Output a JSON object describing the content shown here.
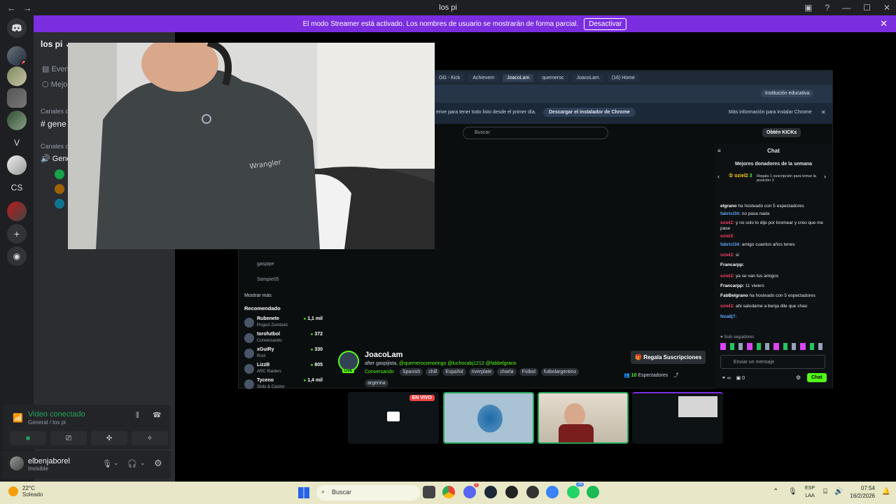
{
  "titlebar": {
    "title": "los pi"
  },
  "banner": {
    "text": "El modo Streamer está activado. Los nombres de usuario se mostrarán de forma parcial.",
    "button": "Desactivar"
  },
  "rail": {
    "badge_count": "1",
    "letter_v": "V",
    "letters_cs": "CS"
  },
  "sidebar": {
    "server_name": "los pi",
    "items": [
      "Even",
      "Mejo"
    ],
    "categories": [
      "Canales d",
      "Canales d"
    ],
    "text_channel": "gene",
    "voice_channel": "Gene"
  },
  "voice": {
    "status": "Video conectado",
    "location": "General / los pi"
  },
  "user": {
    "name": "elbenjaborel",
    "status": "Invisible"
  },
  "browser": {
    "tabs": [
      "OG - Kick",
      "Achievem",
      "JoacoLam",
      "quemeroc",
      "JoacoLam",
      "(16) Home"
    ],
    "profile": "Institución educativa",
    "chrome_msg": "erive para tener todo listo desde el primer día.",
    "chrome_dl": "Descargar el instalador de Chrome",
    "chrome_more": "Más información para instalar Chrome",
    "search_placeholder": "Buscar",
    "kicks": "Obtén KICKs"
  },
  "sidelist": {
    "followed": [
      "gaspipe",
      "Sampie05"
    ],
    "more": "Mostrar más",
    "recommended_title": "Recomendado",
    "recommended": [
      {
        "name": "Rubenete",
        "game": "Project Zomboid",
        "viewers": "1,1 mil"
      },
      {
        "name": "torofutbol",
        "game": "Conversando",
        "viewers": "372"
      },
      {
        "name": "xGuiRy",
        "game": "Rust",
        "viewers": "330"
      },
      {
        "name": "LizzB",
        "game": "ARC Raiders",
        "viewers": "805"
      },
      {
        "name": "Tyceno",
        "game": "Slots & Casino",
        "viewers": "1,4 mil"
      }
    ]
  },
  "stream": {
    "name": "JoacoLam",
    "title_prefix": "after gaspijista, ",
    "title_mentions": "@quemerocomoringo @luchocabj1212 @fabbelgrano",
    "category": "Conversando",
    "tags": [
      "Spanish",
      "chill",
      "Español",
      "riverplate",
      "charla",
      "Fútbol",
      "futbolargentino",
      "argerina"
    ],
    "live": "LIVE",
    "subs_button": "Regala Suscripciones",
    "viewers_num": "10",
    "viewers_label": "Espectadores"
  },
  "chat": {
    "title": "Chat",
    "donors_title": "Mejores donadores de la semana",
    "donor_name": "oziel2",
    "donor_count": "3",
    "donor_note": "Regala 1 suscripción para tomar la posición 2",
    "messages": [
      {
        "user": "elgrano",
        "text": " ha hosteado con 5 espectadores",
        "color": "#ffffff"
      },
      {
        "user": "fabrici34:",
        "text": " no pasa nada",
        "color": "#60a5fa"
      },
      {
        "user": "oziel2:",
        "text": " y no solo lo dije por bromear y creo que me pase",
        "color": "#f43f5e"
      },
      {
        "user": "oziel2:",
        "text": "",
        "color": "#f43f5e"
      },
      {
        "user": "fabrici34:",
        "text": " amigo cuantos años tenes",
        "color": "#60a5fa"
      },
      {
        "user": "oziel2:",
        "text": " si",
        "color": "#f43f5e"
      },
      {
        "user": "Francarpp:",
        "text": "",
        "color": "#ffffff"
      },
      {
        "user": "oziel2:",
        "text": " ya se van tus amigos",
        "color": "#f43f5e"
      },
      {
        "user": "Francarpp:",
        "text": " 11 viwers",
        "color": "#ffffff"
      },
      {
        "user": "FabBelgrano",
        "text": " ha hosteado con 5 espectadores",
        "color": "#ffffff"
      },
      {
        "user": "oziel2:",
        "text": " ahi saludame a benja dile que chao",
        "color": "#f43f5e"
      },
      {
        "user": "Noa8j7:",
        "text": "",
        "color": "#60a5fa"
      }
    ],
    "followers_only": "Solo seguidores",
    "input_placeholder": "Enviar un mensaje",
    "counter": "0",
    "send": "Chat"
  },
  "thumbs": {
    "live_badge": "EN VIVO"
  },
  "taskbar": {
    "temp": "22°C",
    "weather": "Soleado",
    "search": "Buscar",
    "badge_discord": "1",
    "badge_whatsapp": "28",
    "lang1": "ESP",
    "lang2": "LAA",
    "time": "07:54",
    "date": "16/2/2026"
  }
}
